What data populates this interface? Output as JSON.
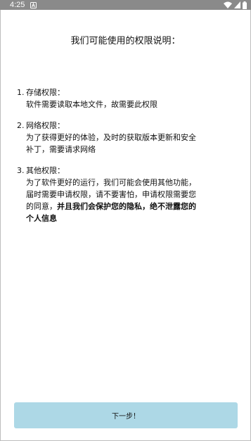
{
  "status_bar": {
    "time": "4:25",
    "icons": [
      "notification-a-icon",
      "wifi-icon",
      "signal-icon",
      "battery-icon"
    ]
  },
  "title": "我们可能使用的权限说明：",
  "sections": [
    {
      "number": "1.",
      "heading": "存储权限：",
      "body_lines": [
        "软件需要读取本地文件，故需要此权限"
      ]
    },
    {
      "number": "2.",
      "heading": "网络权限：",
      "body_lines": [
        "为了获得更好的体验，及时的获取版本更新和安全",
        "补丁，需要请求网络"
      ]
    },
    {
      "number": "3.",
      "heading": "其他权限：",
      "body_lines": [
        "为了软件更好的运行，我们可能会使用其他功能，",
        "届时需要申请权限，请不要害怕，申请权限需要您"
      ],
      "body_mixed_line": {
        "normal": "的同意，",
        "bold": "并且我们会保护您的隐私，绝不泄露您的"
      },
      "body_bold_line": "个人信息"
    }
  ],
  "next_button": {
    "label": "下一步！",
    "color": "#add8e6"
  },
  "colors": {
    "status_bar": "#8a8a8a",
    "text": "#111111",
    "background": "#ffffff"
  }
}
